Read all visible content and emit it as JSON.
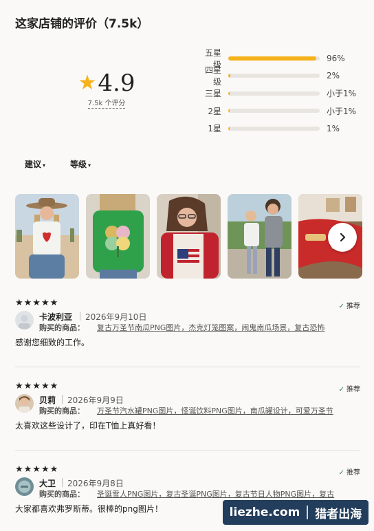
{
  "header": {
    "title": "这家店铺的评价（7.5k）"
  },
  "summary": {
    "star": "★",
    "rating": "4.9",
    "count_label": "7.5k 个评分"
  },
  "distribution": [
    {
      "label": "五星级",
      "percent_text": "96%",
      "fill": 0.96
    },
    {
      "label": "四星级",
      "percent_text": "2%",
      "fill": 0.02
    },
    {
      "label": "三星",
      "percent_text": "小于1%",
      "fill": 0.006
    },
    {
      "label": "2星",
      "percent_text": "小于1%",
      "fill": 0.006
    },
    {
      "label": "1星",
      "percent_text": "1%",
      "fill": 0.01
    }
  ],
  "filters": [
    {
      "label": "建议",
      "caret": "▾"
    },
    {
      "label": "等级",
      "caret": "▾"
    }
  ],
  "photos": [
    "review-photo-1",
    "review-photo-2",
    "review-photo-3",
    "review-photo-4",
    "review-photo-5"
  ],
  "reviews": [
    {
      "stars": "★★★★★",
      "recommend": "推荐",
      "name": "卡波利亚",
      "date": "2026年9月10日",
      "bought_label": "购买的商品：",
      "product": "复古万圣节南瓜PNG图片，杰克灯笼图案，闹鬼南瓜场景，复古恐怖",
      "text": "感谢您细致的工作。"
    },
    {
      "stars": "★★★★★",
      "recommend": "推荐",
      "name": "贝莉",
      "date": "2026年9月9日",
      "bought_label": "购买的商品：",
      "product": "万圣节汽水罐PNG图片，怪诞饮料PNG图片，南瓜罐设计，可爱万圣节",
      "text": "太喜欢这些设计了，印在T恤上真好看！"
    },
    {
      "stars": "★★★★★",
      "recommend": "推荐",
      "name": "大卫",
      "date": "2026年9月8日",
      "bought_label": "购买的商品：",
      "product": "圣诞雪人PNG图片，复古圣诞PNG图片，复古节日人物PNG图片，复古",
      "text": "大家都喜欢弗罗斯蒂。很棒的png图片！"
    }
  ],
  "watermark": {
    "left": "liezhe.com",
    "right": "猎者出海"
  },
  "colors": {
    "accent": "#f5b21b",
    "track": "#e8e5e0",
    "check": "#3a7d44",
    "watermark_bg": "#233e5c"
  }
}
